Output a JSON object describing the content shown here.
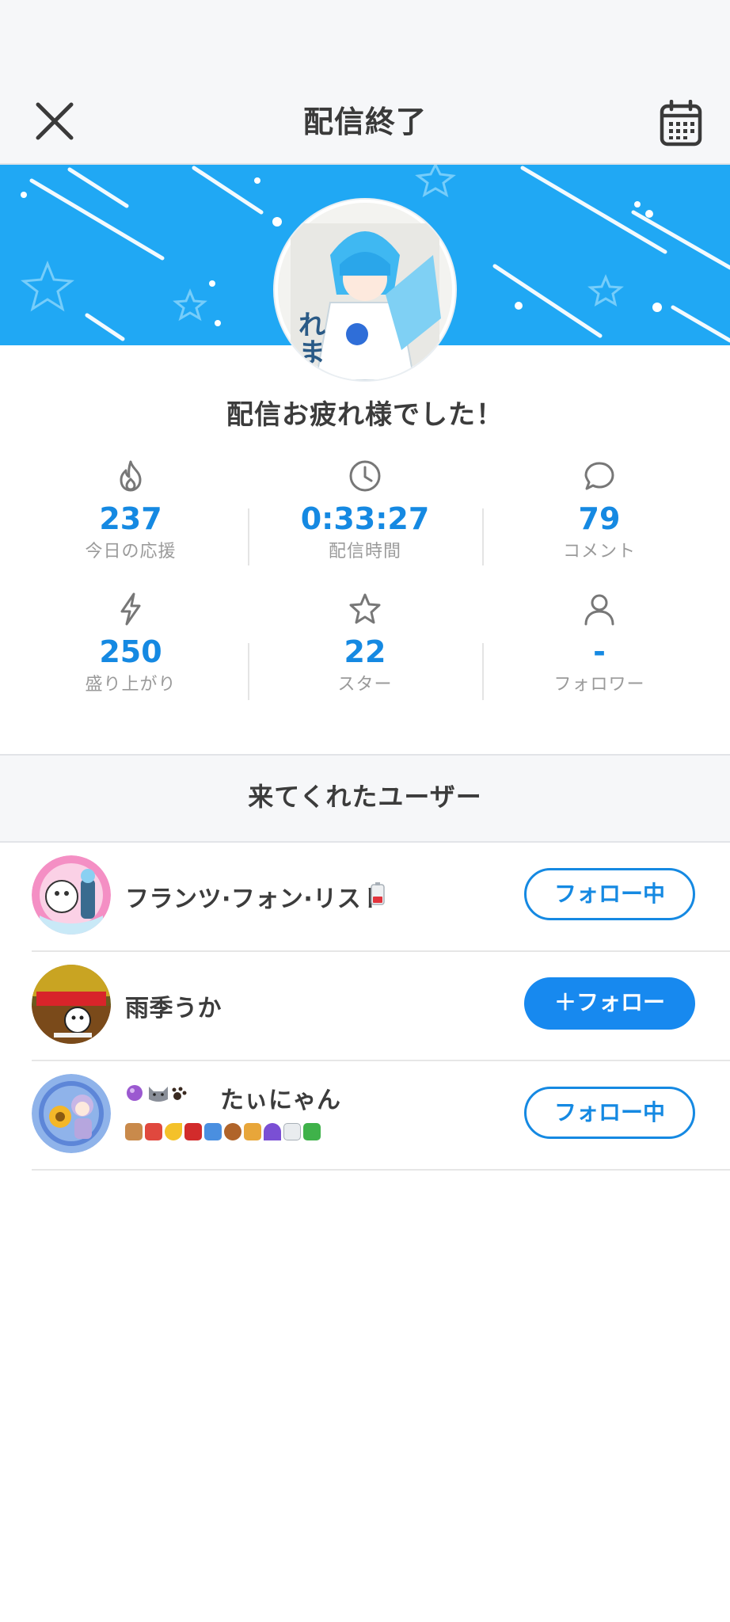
{
  "header": {
    "title": "配信終了"
  },
  "thanks_message": "配信お疲れ様でした！",
  "stats": [
    {
      "icon": "flame-icon",
      "value": "237",
      "label": "今日の応援"
    },
    {
      "icon": "clock-icon",
      "value": "0:33:27",
      "label": "配信時間"
    },
    {
      "icon": "comment-icon",
      "value": "79",
      "label": "コメント"
    },
    {
      "icon": "lightning-icon",
      "value": "250",
      "label": "盛り上がり"
    },
    {
      "icon": "star-icon",
      "value": "22",
      "label": "スター"
    },
    {
      "icon": "person-icon",
      "value": "-",
      "label": "フォロワー"
    }
  ],
  "visitors": {
    "title": "来てくれたユーザー",
    "users": [
      {
        "name": "フランツ·フォン·リスト",
        "follow_label": "フォロー中",
        "following": true
      },
      {
        "name": "雨季うか",
        "follow_label": "＋フォロー",
        "following": false
      },
      {
        "name": "たぃにゃん",
        "follow_label": "フォロー中",
        "following": true
      }
    ]
  },
  "colors": {
    "accent": "#1589e2",
    "banner": "#20a8f4",
    "text": "#3c3c3c",
    "muted": "#9a9a9a"
  }
}
